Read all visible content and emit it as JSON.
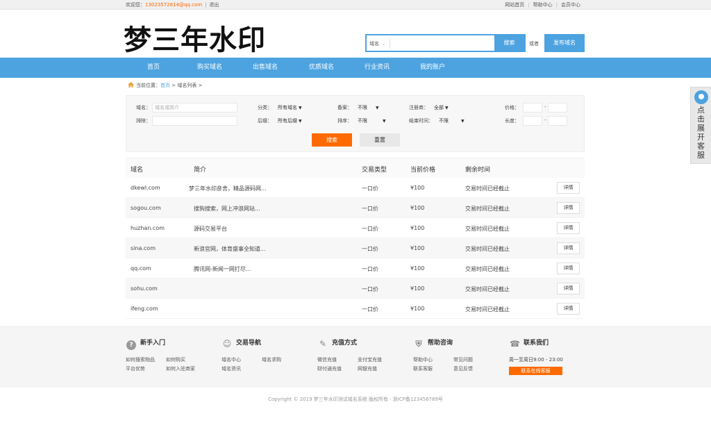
{
  "topbar": {
    "welcome": "欢迎您：",
    "email": "13023572814@qq.com",
    "separator": "|",
    "logout": "退出",
    "links": [
      "网站首页",
      "帮助中心",
      "会员中心"
    ],
    "link_separator": "|"
  },
  "header": {
    "logo": "梦三年水印",
    "search_type": "域名",
    "search_button": "搜索",
    "or_text": "或者",
    "publish_button": "发布域名"
  },
  "nav": [
    "首页",
    "购买域名",
    "出售域名",
    "优质域名",
    "行业资讯",
    "我的账户"
  ],
  "breadcrumb": {
    "label": "当前位置：",
    "home": "首页",
    "sep": ">",
    "current": "域名列表",
    "trailing": ">"
  },
  "filter": {
    "domain_label": "域名：",
    "domain_placeholder": "域名或简介",
    "exclude_label": "排除：",
    "category_label": "分类：",
    "category_value": "所有域名",
    "suffix_label": "后缀：",
    "suffix_value": "所有后缀",
    "record_label": "备案：",
    "record_value": "不限",
    "sort_label": "排序：",
    "sort_value": "不限",
    "registrar_label": "注册商：",
    "registrar_value": "全部",
    "endtime_label": "结束时间：",
    "endtime_value": "不限",
    "price_label": "价格：",
    "length_label": "长度：",
    "dash": "-",
    "search_button": "搜索",
    "reset_button": "重置"
  },
  "table": {
    "headers": [
      "域名",
      "简介",
      "交易类型",
      "当前价格",
      "剩余时间"
    ],
    "rows": [
      {
        "domain": "dkewl.com",
        "desc": "梦三年水印彦舍，精品源码网...",
        "type": "一口价",
        "price": "¥100",
        "remaining": "交易时间已经截止",
        "action": "详情"
      },
      {
        "domain": "sogou.com",
        "desc": "搜狗搜索，网上冲浪网站...",
        "type": "一口价",
        "price": "¥100",
        "remaining": "交易时间已经截止",
        "action": "详情"
      },
      {
        "domain": "huzhan.com",
        "desc": "源码交易平台",
        "type": "一口价",
        "price": "¥100",
        "remaining": "交易时间已经截止",
        "action": "详情"
      },
      {
        "domain": "sina.com",
        "desc": "新浪官网，体育盛事全知道...",
        "type": "一口价",
        "price": "¥100",
        "remaining": "交易时间已经截止",
        "action": "详情"
      },
      {
        "domain": "qq.com",
        "desc": "腾讯网-新闻一网打尽...",
        "type": "一口价",
        "price": "¥100",
        "remaining": "交易时间已经截止",
        "action": "详情"
      },
      {
        "domain": "sohu.com",
        "desc": "",
        "type": "一口价",
        "price": "¥100",
        "remaining": "交易时间已经截止",
        "action": "详情"
      },
      {
        "domain": "ifeng.com",
        "desc": "",
        "type": "一口价",
        "price": "¥100",
        "remaining": "交易时间已经截止",
        "action": "详情"
      }
    ]
  },
  "side_service": "点击展开客服",
  "footer": {
    "cols": [
      {
        "title": "新手入门",
        "icon": "question-icon",
        "links": [
          "如何搜索物品",
          "如何购买",
          "平台优势",
          "如何入驻商家"
        ]
      },
      {
        "title": "交易导航",
        "icon": "user-icon",
        "links": [
          "域名中心",
          "域名求购",
          "域名资讯"
        ]
      },
      {
        "title": "充值方式",
        "icon": "wallet-icon",
        "links": [
          "微信充值",
          "支付宝充值",
          "财付通充值",
          "网银充值"
        ]
      },
      {
        "title": "帮助咨询",
        "icon": "shield-icon",
        "links": [
          "帮助中心",
          "常见问题",
          "联系客服",
          "意见反馈"
        ]
      },
      {
        "title": "联系我们",
        "icon": "phone-icon",
        "hours": "周一至周日9:00 - 23:00",
        "button": "联系在线客服"
      }
    ],
    "copyright": "Copyright © 2019 梦三年水印测试域名系统 版权所有 · 浙ICP备123456789号"
  }
}
